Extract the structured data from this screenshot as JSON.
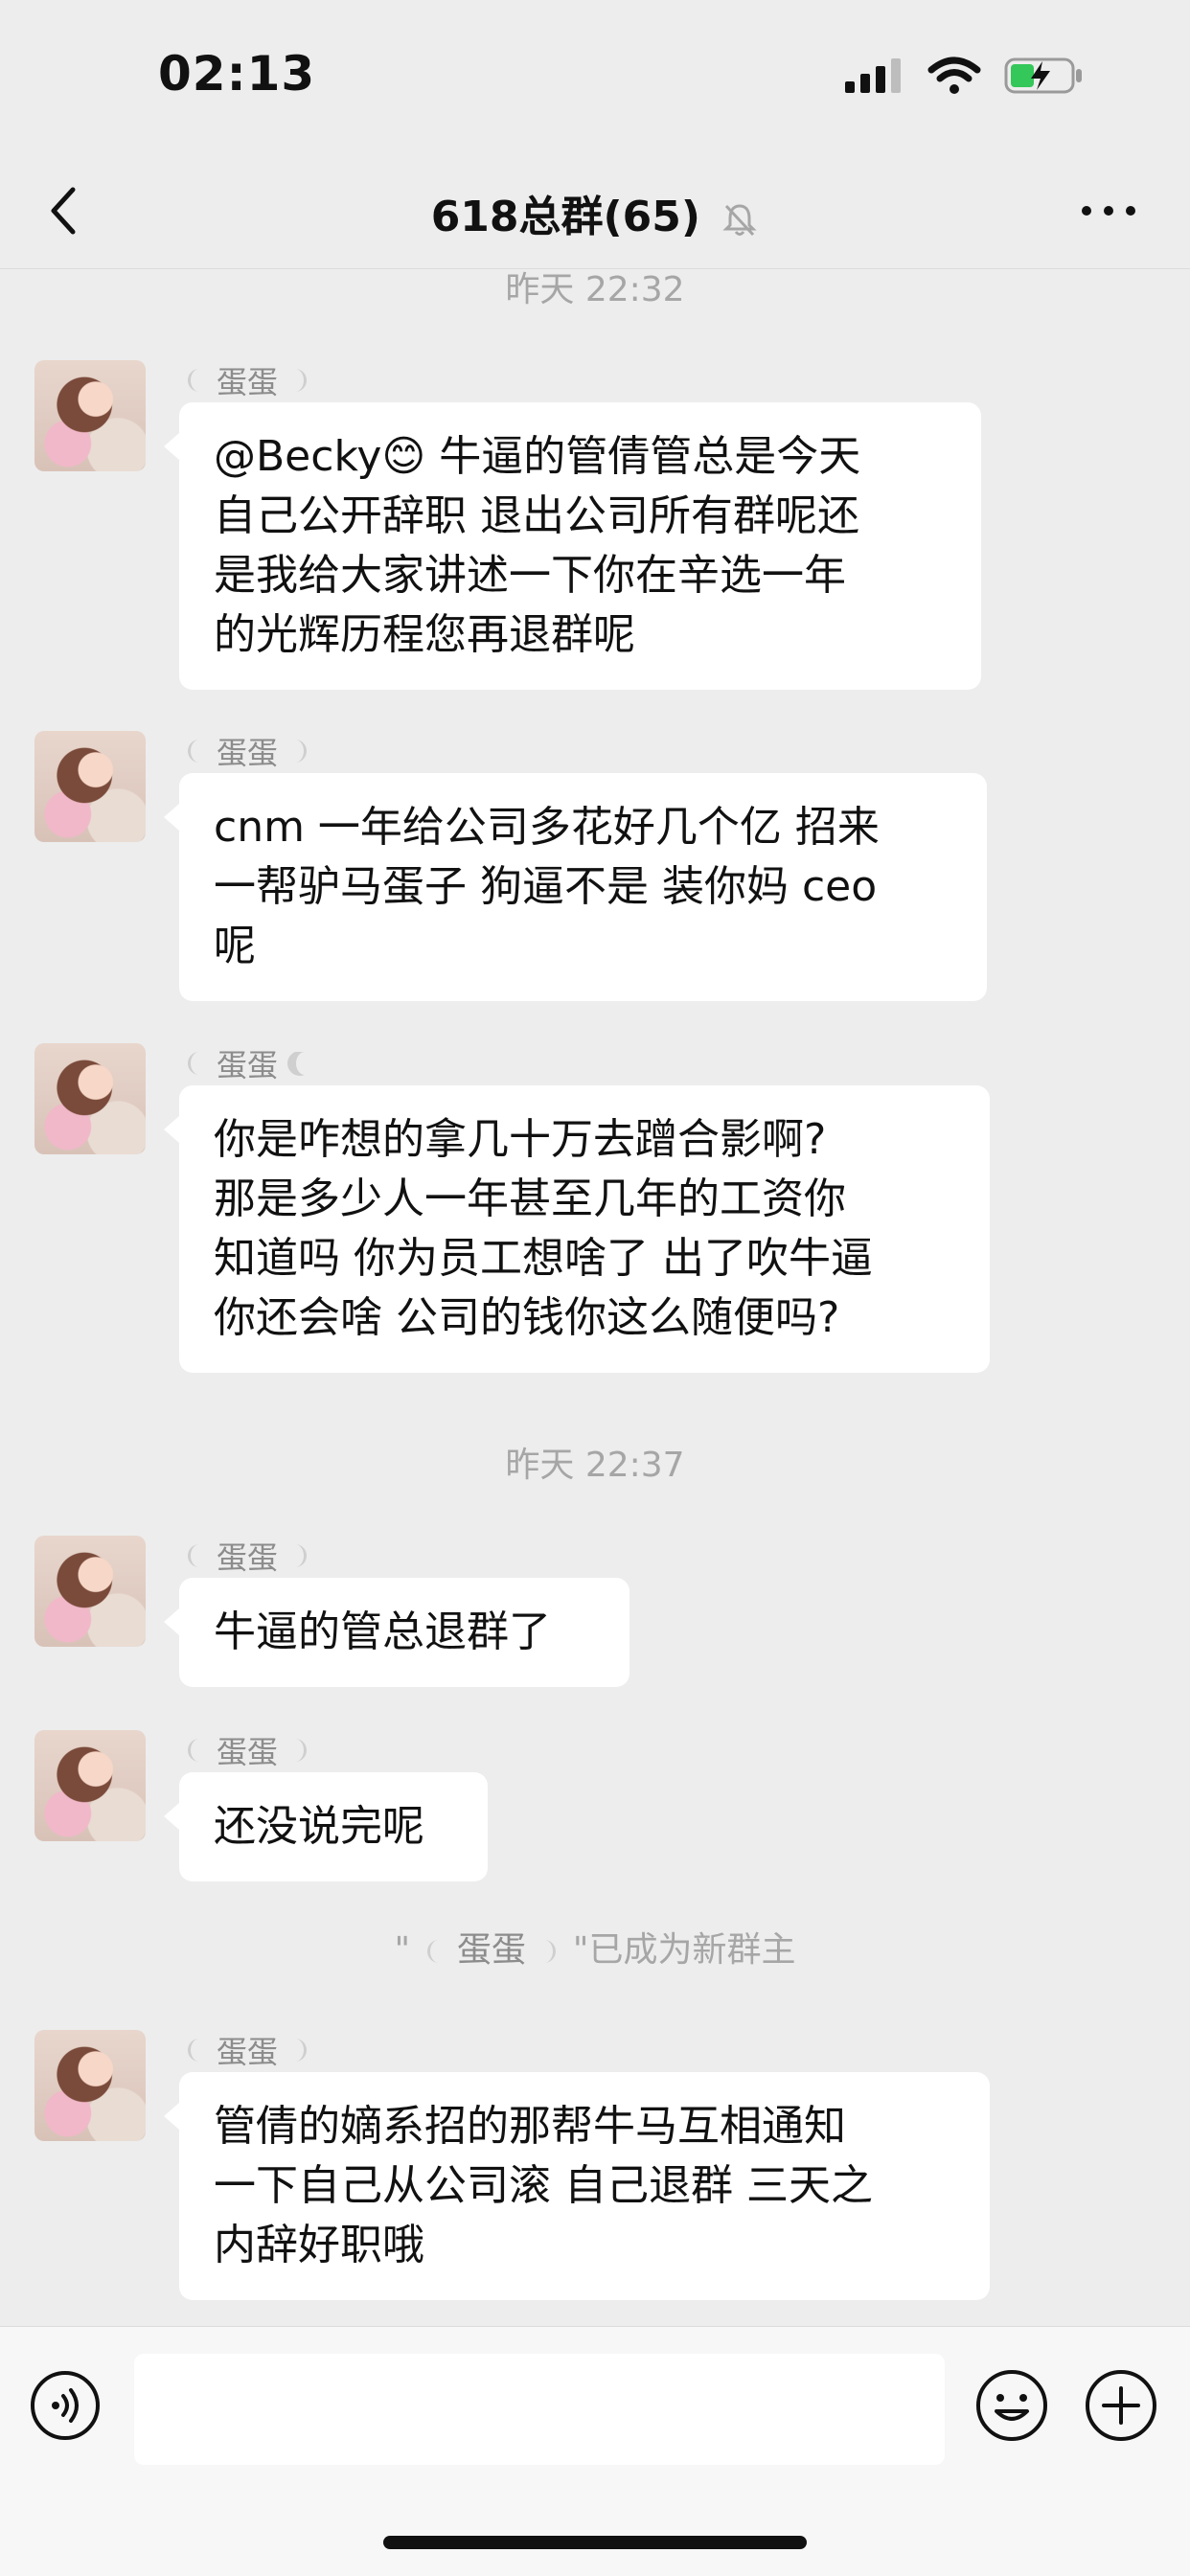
{
  "status_bar": {
    "time": "02:13",
    "battery_icon": "battery-charging-icon"
  },
  "nav": {
    "title": "618总群(65)"
  },
  "messages": [
    {
      "type": "timestamp",
      "text": "昨天 22:32"
    },
    {
      "type": "message",
      "sender": "蛋蛋",
      "lines": [
        "@Becky😊 牛逼的管倩管总是今天",
        "自己公开辞职 退出公司所有群呢还",
        "是我给大家讲述一下你在辛选一年",
        "的光辉历程您再退群呢"
      ]
    },
    {
      "type": "message",
      "sender": "蛋蛋",
      "lines": [
        "cnm 一年给公司多花好几个亿 招来",
        "一帮驴马蛋子 狗逼不是 装你妈 ceo",
        "呢"
      ]
    },
    {
      "type": "message",
      "sender": "蛋蛋",
      "lines": [
        "你是咋想的拿几十万去蹭合影啊?",
        "那是多少人一年甚至几年的工资你",
        "知道吗 你为员工想啥了 出了吹牛逼",
        "你还会啥 公司的钱你这么随便吗?"
      ]
    },
    {
      "type": "timestamp",
      "text": "昨天 22:37"
    },
    {
      "type": "message",
      "sender": "蛋蛋",
      "lines": [
        "牛逼的管总退群了"
      ]
    },
    {
      "type": "message",
      "sender": "蛋蛋",
      "lines": [
        "还没说完呢"
      ]
    },
    {
      "type": "system",
      "prefix": "\"",
      "name": "蛋蛋",
      "suffix": "\"已成为新群主"
    },
    {
      "type": "message",
      "sender": "蛋蛋",
      "lines": [
        "管倩的嫡系招的那帮牛马互相通知",
        "一下自己从公司滚 自己退群 三天之",
        "内辞好职哦"
      ]
    }
  ],
  "input": {
    "placeholder": ""
  },
  "colors": {
    "background": "#ededed",
    "bubble": "#ffffff",
    "muted_text": "#a6a6a6"
  }
}
